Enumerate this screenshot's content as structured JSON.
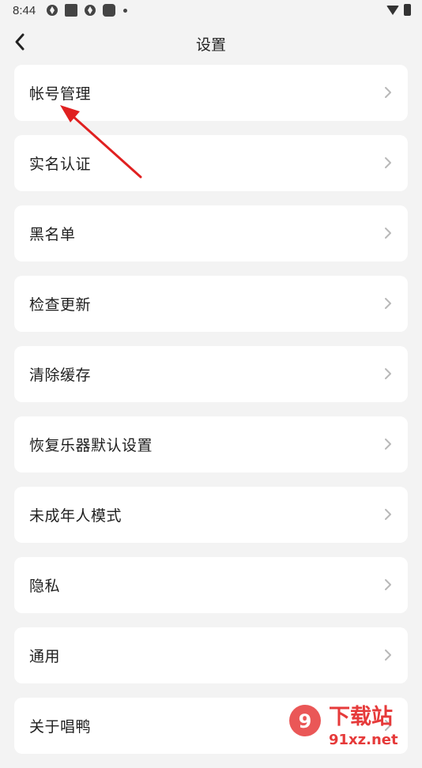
{
  "status": {
    "time": "8:44"
  },
  "header": {
    "title": "设置"
  },
  "settings": {
    "items": [
      {
        "label": "帐号管理"
      },
      {
        "label": "实名认证"
      },
      {
        "label": "黑名单"
      },
      {
        "label": "检查更新"
      },
      {
        "label": "清除缓存"
      },
      {
        "label": "恢复乐器默认设置"
      },
      {
        "label": "未成年人模式"
      },
      {
        "label": "隐私"
      },
      {
        "label": "通用"
      },
      {
        "label": "关于唱鸭"
      }
    ]
  },
  "watermark": {
    "brand": "下载站",
    "domain": "91xz.net"
  },
  "colors": {
    "background": "#f3f3f3",
    "card": "#ffffff",
    "annotation_arrow": "#e02020",
    "watermark_red": "#e63a3a"
  }
}
